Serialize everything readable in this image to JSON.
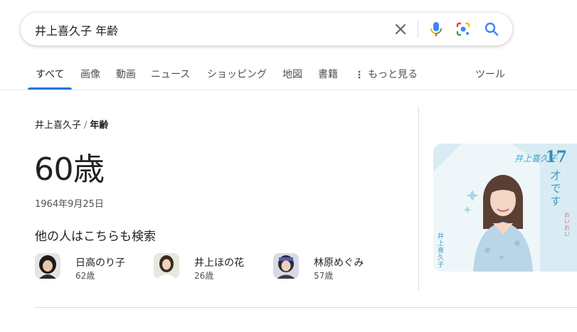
{
  "search": {
    "query": "井上喜久子 年齢"
  },
  "tabs": [
    {
      "label": "すべて"
    },
    {
      "label": "画像"
    },
    {
      "label": "動画"
    },
    {
      "label": "ニュース"
    },
    {
      "label": "ショッピング"
    },
    {
      "label": "地図"
    },
    {
      "label": "書籍"
    },
    {
      "label": "もっと見る"
    },
    {
      "label": "ツール"
    }
  ],
  "result": {
    "breadcrumb": {
      "entity": "井上喜久子",
      "attribute": "年齢"
    },
    "answer": "60歳",
    "birth_date": "1964年9月25日"
  },
  "people_also_search": {
    "heading": "他の人はこちらも検索",
    "people": [
      {
        "name": "日高のり子",
        "age": "62歳"
      },
      {
        "name": "井上ほの花",
        "age": "26歳"
      },
      {
        "name": "林原めぐみ",
        "age": "57歳"
      }
    ]
  },
  "photo": {
    "title": "井上喜久子",
    "number": "17",
    "vertical_text": "才です",
    "small_text": "おいおい",
    "side_text": "井上喜久子"
  },
  "colors": {
    "accent": "#1a73e8",
    "mic_blue": "#4285f4",
    "mic_red": "#ea4335",
    "photo_bg": "#d9ecf3",
    "text": "#202124",
    "secondary_text": "#4d5156"
  }
}
